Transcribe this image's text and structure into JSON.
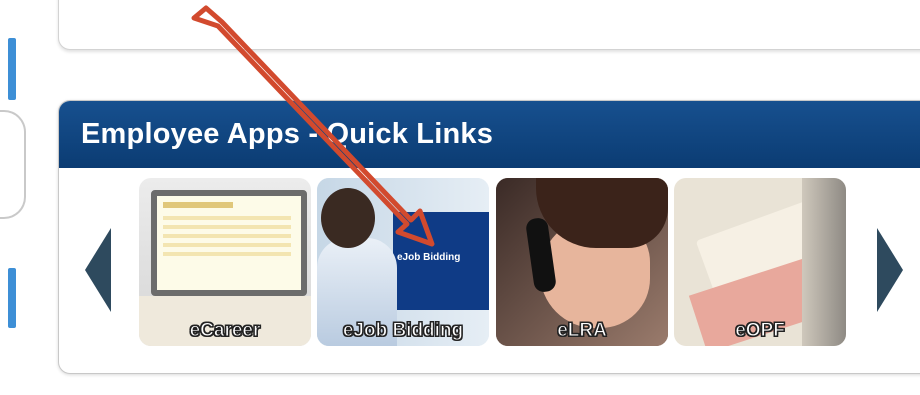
{
  "panel": {
    "title": "Employee Apps - Quick Links"
  },
  "carousel": {
    "prev_icon": "chevron-left-icon",
    "next_icon": "chevron-right-icon",
    "tiles": [
      {
        "label": "eCareer"
      },
      {
        "label": "eJob Bidding",
        "image_text": "eJob Bidding"
      },
      {
        "label": "eLRA"
      },
      {
        "label": "eOPF"
      }
    ]
  },
  "colors": {
    "header": "#0b3c73",
    "arrow": "#2e4a5e",
    "annotation": "#d24a2e"
  }
}
